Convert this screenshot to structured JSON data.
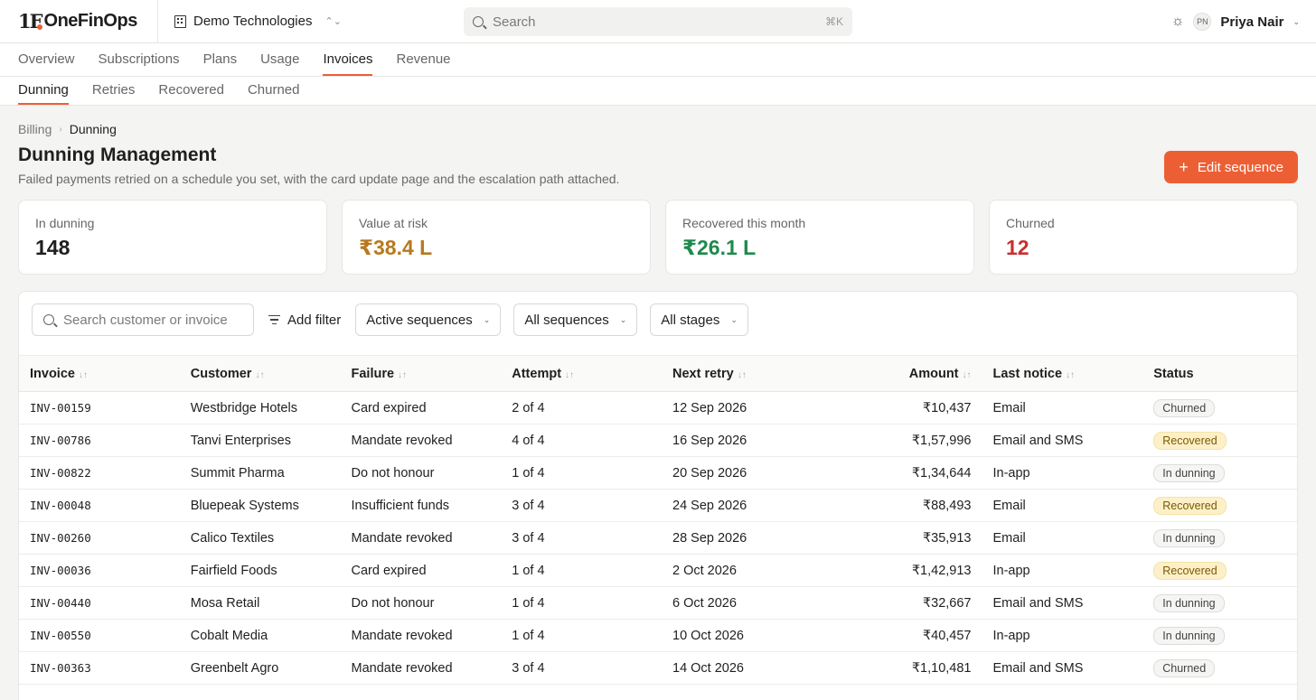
{
  "app": {
    "logo_mark": "1F",
    "logo_text": "OneFinOps",
    "org": "Demo Technologies",
    "search_placeholder": "Search",
    "search_shortcut": "⌘K",
    "user_initials": "PN",
    "user_name": "Priya Nair"
  },
  "nav": {
    "tabs": [
      "Overview",
      "Subscriptions",
      "Plans",
      "Usage",
      "Invoices",
      "Revenue"
    ],
    "active": "Invoices"
  },
  "subnav": {
    "tabs": [
      "Dunning",
      "Retries",
      "Recovered",
      "Churned"
    ],
    "active": "Dunning"
  },
  "breadcrumb": {
    "parent": "Billing",
    "current": "Dunning"
  },
  "page": {
    "title": "Dunning Management",
    "subtitle": "Failed payments retried on a schedule you set, with the card update page and the escalation path attached.",
    "primary_action": "Edit sequence"
  },
  "kpis": [
    {
      "label": "In dunning",
      "value": "148",
      "color": "#1f1f1f"
    },
    {
      "label": "Value at risk",
      "value": "₹38.4 L",
      "color": "#b7791f"
    },
    {
      "label": "Recovered this month",
      "value": "₹26.1 L",
      "color": "#1f8a4c"
    },
    {
      "label": "Churned",
      "value": "12",
      "color": "#c53030"
    }
  ],
  "filters": {
    "search_placeholder": "Search customer or invoice",
    "add_filter": "Add filter",
    "selects": [
      "Active sequences",
      "All sequences",
      "All stages"
    ]
  },
  "table": {
    "columns": [
      "Invoice",
      "Customer",
      "Failure",
      "Attempt",
      "Next retry",
      "Amount",
      "Last notice",
      "Status"
    ],
    "rows": [
      [
        "INV-00159",
        "Westbridge Hotels",
        "Card expired",
        "2 of 4",
        "12 Sep 2026",
        "₹10,437",
        "Email",
        "Churned"
      ],
      [
        "INV-00786",
        "Tanvi Enterprises",
        "Mandate revoked",
        "4 of 4",
        "16 Sep 2026",
        "₹1,57,996",
        "Email and SMS",
        "Recovered"
      ],
      [
        "INV-00822",
        "Summit Pharma",
        "Do not honour",
        "1 of 4",
        "20 Sep 2026",
        "₹1,34,644",
        "In-app",
        "In dunning"
      ],
      [
        "INV-00048",
        "Bluepeak Systems",
        "Insufficient funds",
        "3 of 4",
        "24 Sep 2026",
        "₹88,493",
        "Email",
        "Recovered"
      ],
      [
        "INV-00260",
        "Calico Textiles",
        "Mandate revoked",
        "3 of 4",
        "28 Sep 2026",
        "₹35,913",
        "Email",
        "In dunning"
      ],
      [
        "INV-00036",
        "Fairfield Foods",
        "Card expired",
        "1 of 4",
        "2 Oct 2026",
        "₹1,42,913",
        "In-app",
        "Recovered"
      ],
      [
        "INV-00440",
        "Mosa Retail",
        "Do not honour",
        "1 of 4",
        "6 Oct 2026",
        "₹32,667",
        "Email and SMS",
        "In dunning"
      ],
      [
        "INV-00550",
        "Cobalt Media",
        "Mandate revoked",
        "1 of 4",
        "10 Oct 2026",
        "₹40,457",
        "In-app",
        "In dunning"
      ],
      [
        "INV-00363",
        "Greenbelt Agro",
        "Mandate revoked",
        "3 of 4",
        "14 Oct 2026",
        "₹1,10,481",
        "Email and SMS",
        "Churned"
      ]
    ]
  }
}
